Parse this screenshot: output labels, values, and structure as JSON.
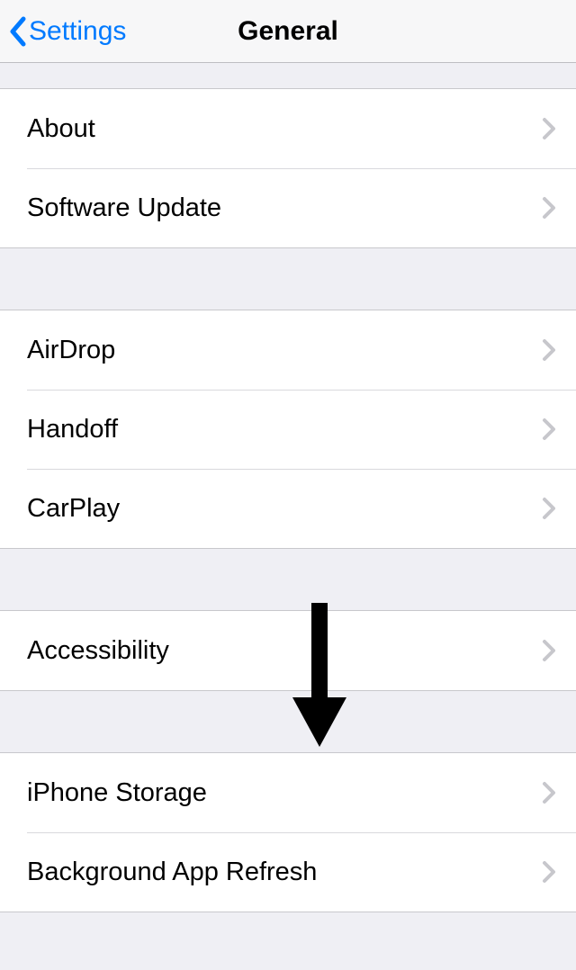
{
  "nav": {
    "back_label": "Settings",
    "title": "General"
  },
  "groups": [
    {
      "items": [
        {
          "id": "about",
          "label": "About"
        },
        {
          "id": "software-update",
          "label": "Software Update"
        }
      ]
    },
    {
      "items": [
        {
          "id": "airdrop",
          "label": "AirDrop"
        },
        {
          "id": "handoff",
          "label": "Handoff"
        },
        {
          "id": "carplay",
          "label": "CarPlay"
        }
      ]
    },
    {
      "items": [
        {
          "id": "accessibility",
          "label": "Accessibility"
        }
      ]
    },
    {
      "items": [
        {
          "id": "iphone-storage",
          "label": "iPhone Storage"
        },
        {
          "id": "background-app-refresh",
          "label": "Background App Refresh"
        }
      ]
    }
  ]
}
